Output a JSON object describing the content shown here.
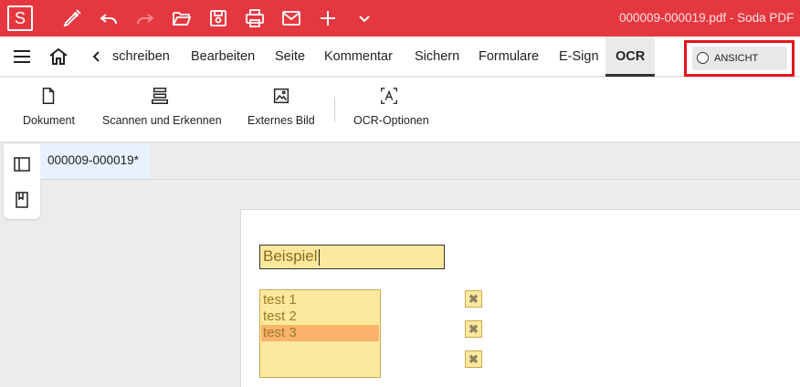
{
  "app": {
    "logo_letter": "S",
    "window_title": "000009-000019.pdf  -  Soda PDF",
    "accent_color": "#e5373f"
  },
  "toolbar_icons": [
    "pen-icon",
    "undo-icon",
    "redo-icon",
    "open-folder-icon",
    "save-icon",
    "print-icon",
    "mail-icon",
    "plus-icon",
    "chevron-down-icon"
  ],
  "menu": {
    "items": [
      "schreiben",
      "Bearbeiten",
      "Seite",
      "Kommentar",
      "Sichern",
      "Formulare",
      "E-Sign",
      "OCR"
    ],
    "active": "OCR",
    "view_toggle_label": "ANSICHT"
  },
  "ribbon": {
    "buttons": [
      "Dokument",
      "Scannen und Erkennen",
      "Externes Bild",
      "OCR-Optionen"
    ]
  },
  "document_tab": {
    "name": "000009-000019*"
  },
  "form": {
    "text_field_value": "Beispiel",
    "list_options": [
      "test 1",
      "test 2",
      "test 3"
    ],
    "selected_option": "test 3",
    "checkbox_mark": "✖"
  }
}
